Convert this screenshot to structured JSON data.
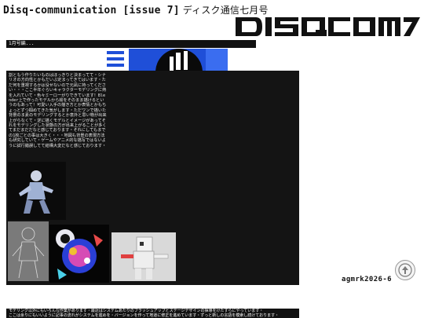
{
  "header": {
    "title": "Disq-communication [issue 7]",
    "subtitle": "ディスク通信七月号"
  },
  "logo": {
    "text": "DISQCOM"
  },
  "strip": {
    "label": "1月号編..."
  },
  "panel": {
    "body": "割ともう作りたいものはほっきりと決まってて・シナリオの方向性とかもだいぶ定まってきてはいます・ただ何を重視するかは没せないので元凪に持ってください・・・ここ半年ぐらいキャラクターモデリングに熱を入れていて・色々ミーローがりできています！Blender上で作ったモデルから絵をそのまま描けるというのもあって！可愛い入手の描き方とか表情とかもちょっとずつ掴めてきた気がします・ただワンで描いた背景のま素のモデリングするとか意外と思い物が出来上がらなくて・逆に描くモデルとイメージがあってそれをモデリングした状態の方が出来上がることが多くてまだまだだなと感じております・それにしてもまでの1枚ごとの事は大きく・・・地図も背景の表現方法も研究していて・ゲームやアニメ的な描写ではないように試行錯誤してて結構大変だなと感じております・"
  },
  "gallery": [
    {
      "name": "figure-render-1"
    },
    {
      "name": "wireframe-sketch"
    },
    {
      "name": "colorful-character-art"
    },
    {
      "name": "robot-render"
    }
  ],
  "signature": "agmrk2026-6",
  "footer": {
    "line1": "モデリング以外にもいろんな作業があります・最近はシステムあたりのブラッシュアップとステージデザインの揮導をけたすらにやっています・",
    "line2": "ここは余りにもいいように記事の流れがシステムを進めを・バージョンを作って地道に修正を進めています・ずっと新しの言語を模索し続けております・"
  },
  "colors": {
    "accent": "#1f4fd8",
    "panel": "#141414"
  }
}
